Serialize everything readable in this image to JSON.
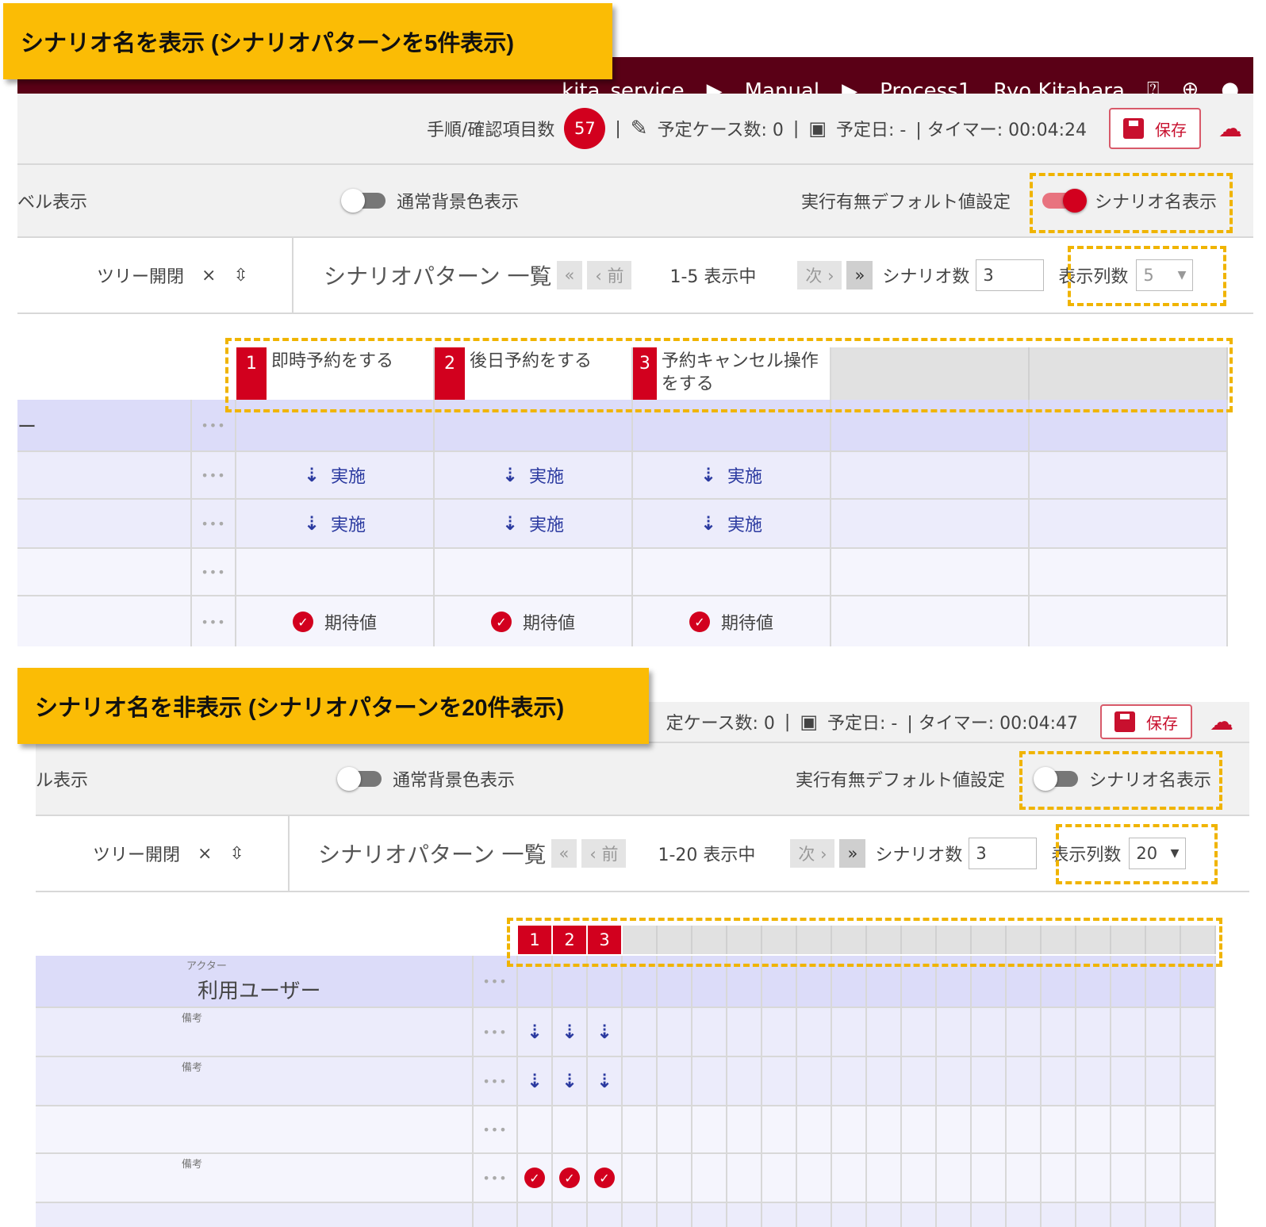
{
  "panel1": {
    "label": "シナリオ名を表示 (シナリオパターンを5件表示)",
    "topbar": {
      "service": "kita_service",
      "manual": "Manual",
      "process": "Process1",
      "user": "Ryo Kitahara",
      "help_icon": "help-circle-icon",
      "globe_icon": "globe-icon"
    },
    "status": {
      "steps_label": "手順/確認項目数",
      "steps_count": "57",
      "sep": "|",
      "planned_cases": "予定ケース数: 0",
      "sep2": "|",
      "planned_date": "予定日: -",
      "timer": "| タイマー: 00:04:24",
      "save_label": "保存"
    },
    "toggles": {
      "level_label": "ベル表示",
      "bg_label": "通常背景色表示",
      "default_label": "実行有無デフォルト値設定",
      "scenario_label": "シナリオ名表示",
      "scenario_on": true
    },
    "nav": {
      "tree_label": "ツリー開閉",
      "title": "シナリオパターン 一覧",
      "first": "«",
      "prev": "‹ 前",
      "range": "1-5 表示中",
      "next": "次 ›",
      "last": "»",
      "count_label": "シナリオ数",
      "count_value": "3",
      "cols_label": "表示列数",
      "cols_value": "5"
    },
    "scenarios": [
      {
        "num": "1",
        "name": "即時予約をする"
      },
      {
        "num": "2",
        "name": "後日予約をする"
      },
      {
        "num": "3",
        "name": "予約キャンセル操作をする"
      }
    ],
    "rows": [
      {
        "label": "ー",
        "cells": [
          "",
          "",
          ""
        ]
      },
      {
        "label": "",
        "cells": [
          "実施",
          "実施",
          "実施"
        ]
      },
      {
        "label": "",
        "cells": [
          "実施",
          "実施",
          "実施"
        ]
      },
      {
        "label": "",
        "cells": [
          "",
          "",
          ""
        ]
      },
      {
        "label": "",
        "cells": [
          "期待値",
          "期待値",
          "期待値"
        ]
      }
    ]
  },
  "panel2": {
    "label": "シナリオ名を非表示 (シナリオパターンを20件表示)",
    "status": {
      "planned_cases": "定ケース数: 0",
      "sep": "|",
      "planned_date": "予定日: -",
      "timer": "| タイマー: 00:04:47",
      "save_label": "保存"
    },
    "toggles": {
      "level_label": "ル表示",
      "bg_label": "通常背景色表示",
      "default_label": "実行有無デフォルト値設定",
      "scenario_label": "シナリオ名表示",
      "scenario_on": false
    },
    "nav": {
      "tree_label": "ツリー開閉",
      "title": "シナリオパターン 一覧",
      "first": "«",
      "prev": "‹ 前",
      "range": "1-20 表示中",
      "next": "次 ›",
      "last": "»",
      "count_label": "シナリオ数",
      "count_value": "3",
      "cols_label": "表示列数",
      "cols_value": "20"
    },
    "scenario_nums": [
      "1",
      "2",
      "3"
    ],
    "actor_small": "アクター",
    "actor_name": "利用ユーザー",
    "remark_small": "備考"
  },
  "colors": {
    "accent": "#d2001e",
    "topbar": "#5a0016",
    "highlight": "#fbbc05"
  }
}
